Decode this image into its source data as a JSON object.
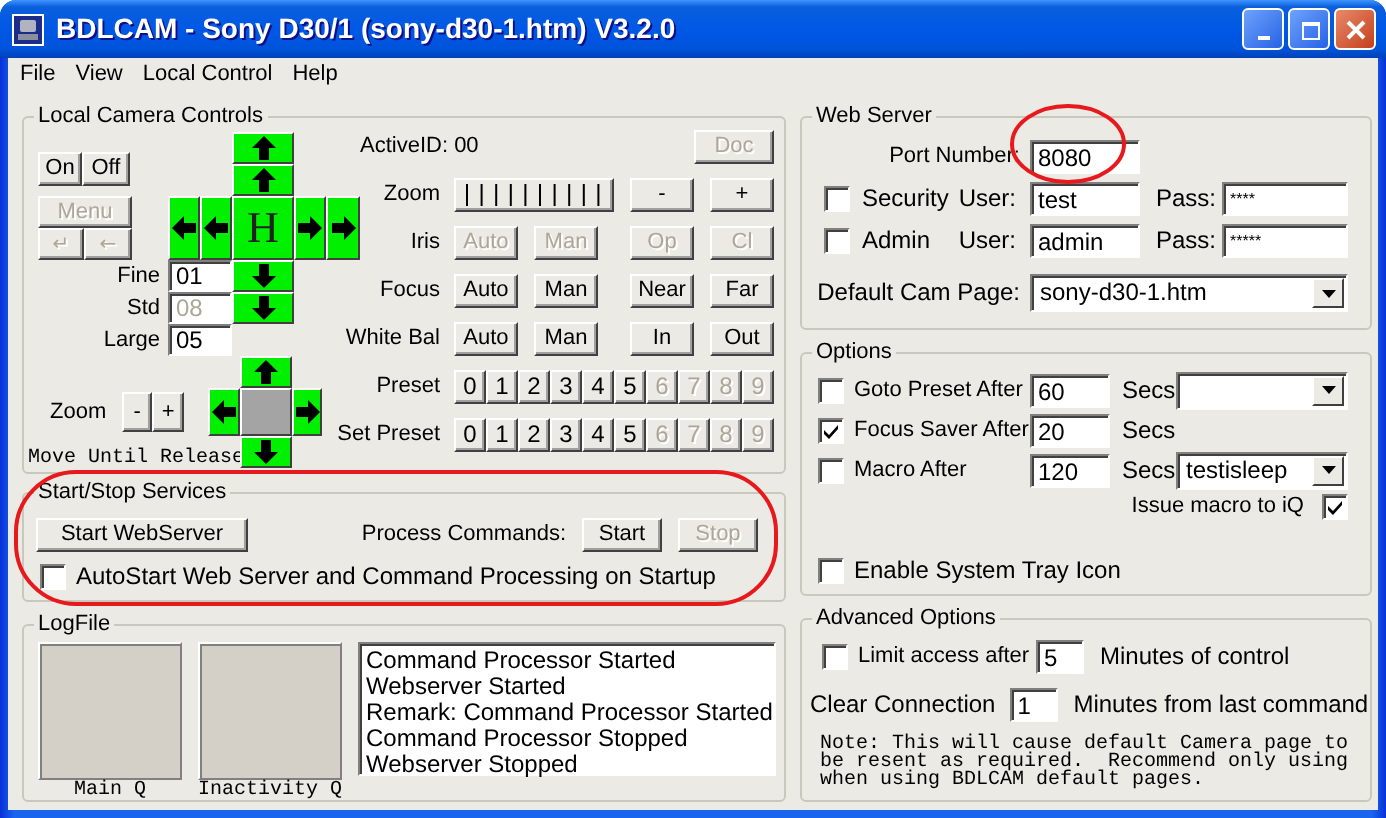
{
  "window": {
    "title": "BDLCAM - Sony D30/1 (sony-d30-1.htm) V3.2.0"
  },
  "menu": [
    "File",
    "View",
    "Local Control",
    "Help"
  ],
  "camera_controls": {
    "title": "Local Camera Controls",
    "power_buttons": [
      {
        "label": "On",
        "disabled": false
      },
      {
        "label": "Off",
        "disabled": false
      }
    ],
    "menu_button": {
      "label": "Menu",
      "disabled": true
    },
    "menu_keys": [
      {
        "label": "↵",
        "disabled": true
      },
      {
        "label": "←",
        "disabled": true
      }
    ],
    "steps": [
      {
        "label": "Fine",
        "value": "01",
        "disabled": false
      },
      {
        "label": "Std",
        "value": "08",
        "disabled": true
      },
      {
        "label": "Large",
        "value": "05",
        "disabled": false
      }
    ],
    "pan_pad": {
      "home": "H"
    },
    "zoom": {
      "label": "Zoom",
      "buttons": [
        "-",
        "+"
      ]
    },
    "move_note": "Move Until Release",
    "active_id": "ActiveID: 00",
    "doc_button": {
      "label": "Doc",
      "disabled": true
    },
    "zoom_row": {
      "label": "Zoom",
      "buttons": [
        {
          "label": "-",
          "disabled": false
        },
        {
          "label": "+",
          "disabled": false
        }
      ]
    },
    "rows": [
      {
        "label": "Iris",
        "buttons": [
          {
            "label": "Auto",
            "disabled": true
          },
          {
            "label": "Man",
            "disabled": true
          },
          {
            "label": "Op",
            "disabled": true
          },
          {
            "label": "Cl",
            "disabled": true
          }
        ]
      },
      {
        "label": "Focus",
        "buttons": [
          {
            "label": "Auto",
            "disabled": false
          },
          {
            "label": "Man",
            "disabled": false
          },
          {
            "label": "Near",
            "disabled": false
          },
          {
            "label": "Far",
            "disabled": false
          }
        ]
      },
      {
        "label": "White Bal",
        "buttons": [
          {
            "label": "Auto",
            "disabled": false
          },
          {
            "label": "Man",
            "disabled": false
          },
          {
            "label": "In",
            "disabled": false
          },
          {
            "label": "Out",
            "disabled": false
          }
        ]
      }
    ],
    "presets": [
      {
        "label": "Preset",
        "buttons": [
          {
            "label": "0",
            "disabled": false
          },
          {
            "label": "1",
            "disabled": false
          },
          {
            "label": "2",
            "disabled": false
          },
          {
            "label": "3",
            "disabled": false
          },
          {
            "label": "4",
            "disabled": false
          },
          {
            "label": "5",
            "disabled": false
          },
          {
            "label": "6",
            "disabled": true
          },
          {
            "label": "7",
            "disabled": true
          },
          {
            "label": "8",
            "disabled": true
          },
          {
            "label": "9",
            "disabled": true
          }
        ]
      },
      {
        "label": "Set Preset",
        "buttons": [
          {
            "label": "0",
            "disabled": false
          },
          {
            "label": "1",
            "disabled": false
          },
          {
            "label": "2",
            "disabled": false
          },
          {
            "label": "3",
            "disabled": false
          },
          {
            "label": "4",
            "disabled": false
          },
          {
            "label": "5",
            "disabled": false
          },
          {
            "label": "6",
            "disabled": true
          },
          {
            "label": "7",
            "disabled": true
          },
          {
            "label": "8",
            "disabled": true
          },
          {
            "label": "9",
            "disabled": true
          }
        ]
      }
    ]
  },
  "services": {
    "title": "Start/Stop Services",
    "webserver_button": {
      "label": "Start WebServer",
      "disabled": false
    },
    "process_label": "Process Commands:",
    "process_buttons": [
      {
        "label": "Start",
        "disabled": false
      },
      {
        "label": "Stop",
        "disabled": true
      }
    ],
    "autostart": {
      "label": "AutoStart Web Server and Command Processing on Startup",
      "checked": false
    }
  },
  "logfile": {
    "title": "LogFile",
    "queues": [
      {
        "label": "Main Q"
      },
      {
        "label": "Inactivity Q"
      }
    ],
    "lines": [
      "Command Processor Started",
      "Webserver Started",
      "Remark: Command Processor Started",
      "Command Processor Stopped",
      "Webserver Stopped"
    ]
  },
  "web_server": {
    "title": "Web Server",
    "port": {
      "label": "Port Number:",
      "value": "8080"
    },
    "accounts": [
      {
        "label": "Security",
        "checked": false,
        "user_label": "User:",
        "user": "test",
        "pass_label": "Pass:",
        "pass": "****"
      },
      {
        "label": "Admin",
        "checked": false,
        "user_label": "User:",
        "user": "admin",
        "pass_label": "Pass:",
        "pass": "*****"
      }
    ],
    "default_page": {
      "label": "Default Cam Page:",
      "value": "sony-d30-1.htm"
    }
  },
  "options": {
    "title": "Options",
    "items": [
      {
        "kind": "with_select",
        "label": "Goto Preset After",
        "checked": false,
        "value": "60",
        "unit": "Secs"
      },
      {
        "kind": "plain",
        "label": "Focus Saver After",
        "checked": true,
        "value": "20",
        "unit": "Secs"
      },
      {
        "kind": "with_select",
        "label": "Macro After",
        "checked": false,
        "value": "120",
        "unit": "Secs",
        "select": "testisleep"
      }
    ],
    "issue_macro": {
      "label": "Issue macro to iQ",
      "checked": true
    },
    "tray": {
      "label": "Enable System Tray Icon",
      "checked": false
    }
  },
  "advanced": {
    "title": "Advanced Options",
    "limit": {
      "label": "Limit access after",
      "checked": false,
      "value": "5",
      "unit": "Minutes of control"
    },
    "clear": {
      "label": "Clear Connection",
      "value": "1",
      "unit": "Minutes from last command"
    },
    "note": "Note: This will cause default Camera page to be resent as required.  Recommend only using when using BDLCAM default pages."
  }
}
